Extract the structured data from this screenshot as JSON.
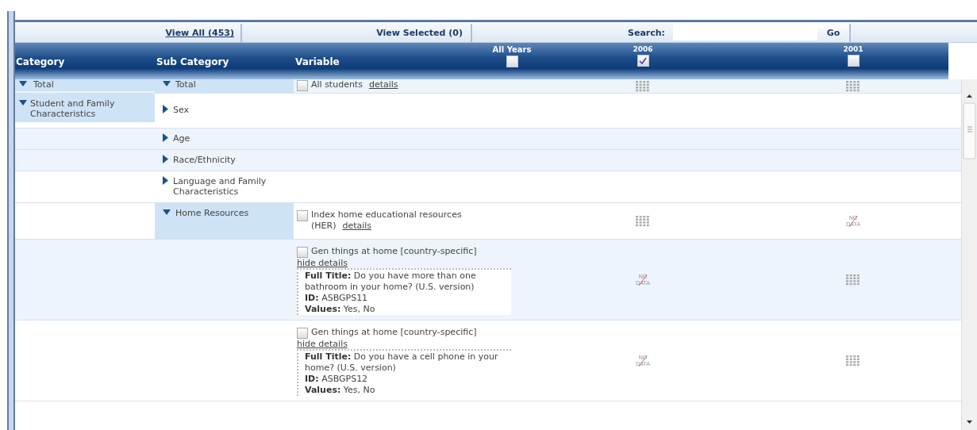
{
  "toolbar": {
    "view_all": "View All (453)",
    "view_selected": "View Selected (0)",
    "search_label": "Search:",
    "go_button": "Go"
  },
  "header": {
    "columns": [
      "Category",
      "Sub Category",
      "Variable"
    ],
    "years": [
      {
        "label": "All Years",
        "checked": false
      },
      {
        "label": "2006",
        "checked": true
      },
      {
        "label": "2001",
        "checked": false
      }
    ]
  },
  "rows": [
    {
      "shaded": true,
      "category": {
        "label": "Total",
        "expanded": true
      },
      "subcategory": {
        "label": "Total",
        "expanded": true,
        "selected": true
      },
      "variable": {
        "label": "All students",
        "link": "details",
        "checked": false
      },
      "cells": [
        {
          "kind": "data"
        },
        {
          "kind": "data"
        }
      ]
    },
    {
      "shaded": false,
      "category": {
        "label": "Student and Family Characteristics",
        "expanded": true
      },
      "subcategory": {
        "label": "Sex",
        "expanded": false,
        "selected": false
      }
    },
    {
      "shaded": true,
      "subcategory": {
        "label": "Age",
        "expanded": false,
        "selected": false
      }
    },
    {
      "shaded": true,
      "subcategory": {
        "label": "Race/Ethnicity",
        "expanded": false,
        "selected": false
      }
    },
    {
      "shaded": false,
      "subcategory": {
        "label": "Language and Family Characteristics",
        "expanded": false,
        "selected": false
      }
    },
    {
      "shaded": false,
      "subcategory": {
        "label": "Home Resources",
        "expanded": true,
        "selected": true
      },
      "variable": {
        "label": "Index home educational resources (HER)",
        "link": "details",
        "checked": false
      },
      "cells": [
        {
          "kind": "data"
        },
        {
          "kind": "no_data",
          "label": "NO DATA"
        }
      ]
    },
    {
      "shaded": true,
      "variable": {
        "label": "Gen things at home [country-specific]",
        "link": "hide details",
        "checked": false,
        "details": [
          {
            "label": "Full Title:",
            "value": "Do you have more than one bathroom in your home? (U.S. version)"
          },
          {
            "label": "ID:",
            "value": "ASBGPS11"
          },
          {
            "label": "Values:",
            "value": "Yes, No"
          }
        ]
      },
      "cells": [
        {
          "kind": "no_data",
          "label": "NO DATA"
        },
        {
          "kind": "data"
        }
      ]
    },
    {
      "shaded": false,
      "variable": {
        "label": "Gen things at home [country-specific]",
        "link": "hide details",
        "checked": false,
        "details": [
          {
            "label": "Full Title:",
            "value": "Do you have a cell phone in your home? (U.S. version)"
          },
          {
            "label": "ID:",
            "value": "ASBGPS12"
          },
          {
            "label": "Values:",
            "value": "Yes, No"
          }
        ]
      },
      "cells": [
        {
          "kind": "no_data",
          "label": "NO DATA"
        },
        {
          "kind": "data"
        }
      ]
    }
  ]
}
